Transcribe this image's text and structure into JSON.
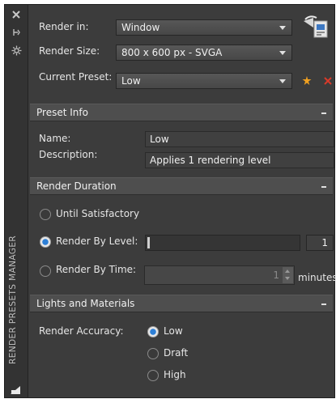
{
  "sidebar": {
    "vertical_title": "RENDER PRESETS MANAGER"
  },
  "render_in": {
    "label": "Render in:",
    "value": "Window"
  },
  "render_size": {
    "label": "Render Size:",
    "value": "800 x 600 px - SVGA"
  },
  "current_preset": {
    "label": "Current Preset:",
    "value": "Low"
  },
  "preset_info": {
    "title": "Preset Info",
    "name_label": "Name:",
    "name_value": "Low",
    "description_label": "Description:",
    "description_value": "Applies 1 rendering level"
  },
  "render_duration": {
    "title": "Render Duration",
    "until_satisfactory": "Until Satisfactory",
    "by_level": "Render By Level:",
    "level_value": "1",
    "by_time": "Render By Time:",
    "time_value": "1",
    "time_unit": "minutes",
    "selected": "Render By Level:"
  },
  "lights_materials": {
    "title": "Lights and Materials",
    "accuracy_label": "Render Accuracy:",
    "options": [
      "Low",
      "Draft",
      "High"
    ],
    "selected": "Low"
  },
  "colors": {
    "panel_bg": "#3c3c3c",
    "accent_blue": "#2d7fd6",
    "star_orange": "#f0a020",
    "delete_red": "#d83a2a"
  },
  "icons": [
    "close-icon",
    "pin-icon",
    "settings-icon",
    "render-window-icon",
    "new-preset-star-icon",
    "delete-preset-icon",
    "palette-corner-icon"
  ]
}
